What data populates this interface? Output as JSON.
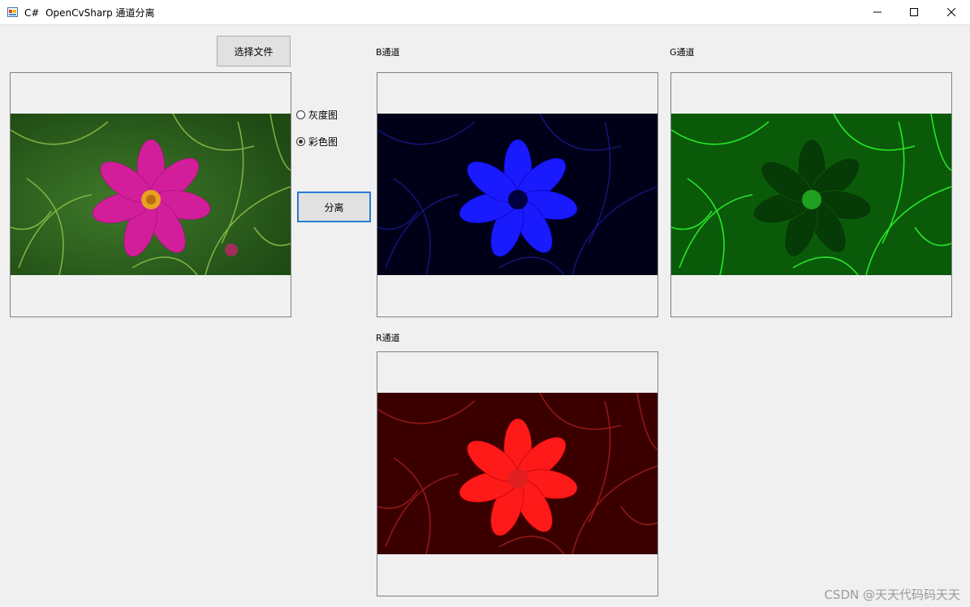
{
  "window": {
    "title": "C#  OpenCvSharp 通道分离",
    "icon": "winforms-app-icon",
    "controls": [
      "minimize-icon",
      "maximize-icon",
      "close-icon"
    ]
  },
  "buttons": {
    "select_file": "选择文件",
    "split": "分离"
  },
  "radios": [
    {
      "label": "灰度图",
      "checked": false
    },
    {
      "label": "彩色图",
      "checked": true
    }
  ],
  "labels": {
    "b_channel": "B通道",
    "g_channel": "G通道",
    "r_channel": "R通道"
  },
  "images": {
    "original": "cosmos-flower-photo-original",
    "b": "cosmos-flower-blue-channel",
    "g": "cosmos-flower-green-channel",
    "r": "cosmos-flower-red-channel"
  },
  "colors": {
    "focus_border": "#2b7cd3",
    "flower_magenta": "#d21e9b",
    "blue_channel": "#1a1aff",
    "green_channel": "#00cc00",
    "red_channel": "#ff1a1a"
  },
  "watermark": "CSDN @天天代码码天天"
}
